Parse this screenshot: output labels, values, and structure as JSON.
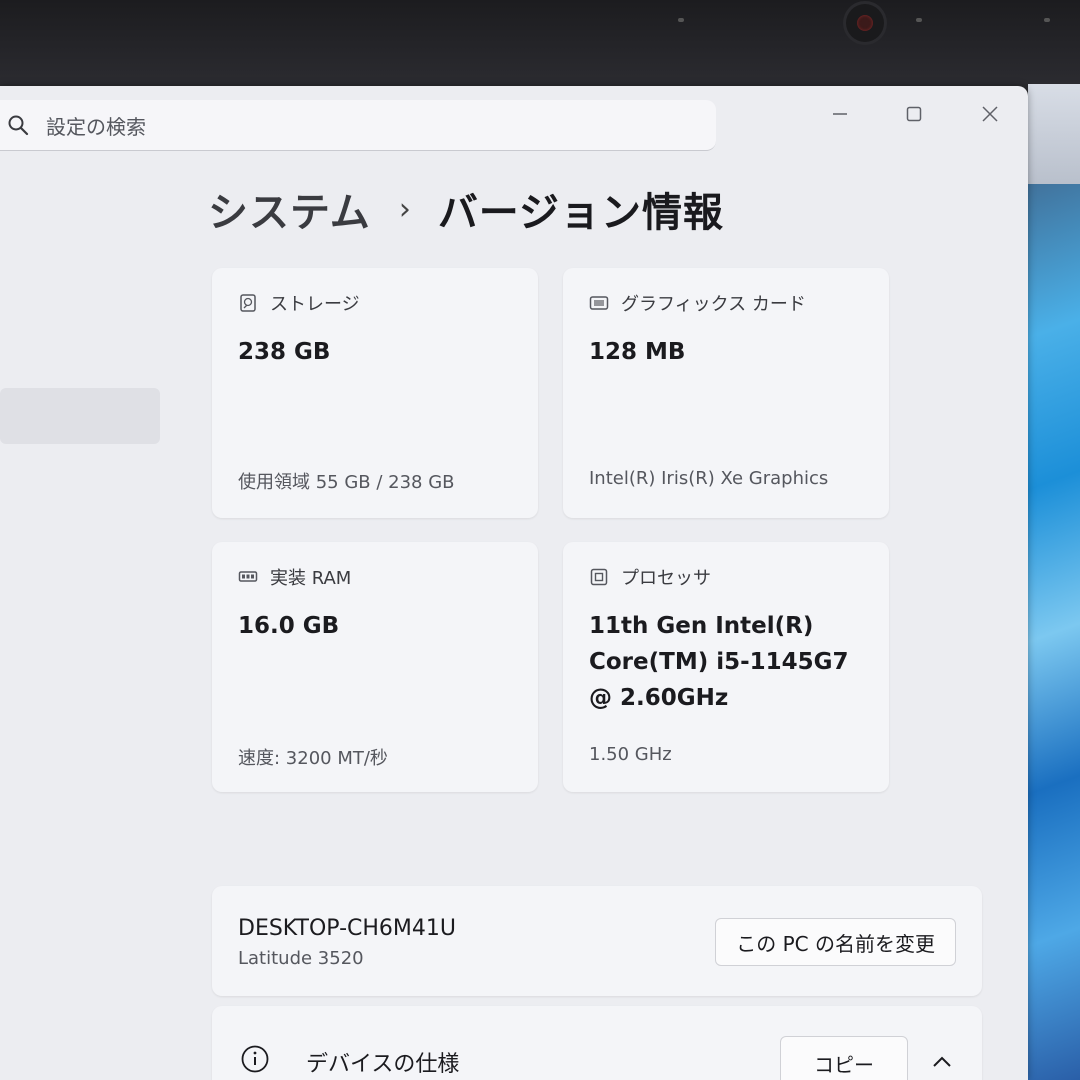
{
  "search": {
    "placeholder": "設定の検索"
  },
  "breadcrumb": {
    "parent": "システム",
    "separator": "›",
    "current": "バージョン情報"
  },
  "cards": {
    "storage": {
      "label": "ストレージ",
      "value": "238 GB",
      "footnote": "使用領域 55 GB / 238 GB",
      "icon": "hard-drive-icon"
    },
    "graphics": {
      "label": "グラフィックス カード",
      "value": "128 MB",
      "footnote": "Intel(R) Iris(R) Xe Graphics",
      "icon": "gpu-icon"
    },
    "ram": {
      "label": "実装 RAM",
      "value": "16.0 GB",
      "footnote": "速度: 3200 MT/秒",
      "icon": "memory-icon"
    },
    "processor": {
      "label": "プロセッサ",
      "value": "11th Gen Intel(R) Core(TM) i5-1145G7 @ 2.60GHz",
      "footnote": "1.50 GHz",
      "icon": "cpu-icon"
    }
  },
  "device": {
    "name": "DESKTOP-CH6M41U",
    "model": "Latitude 3520",
    "rename_label": "この PC の名前を変更"
  },
  "specs": {
    "label": "デバイスの仕様",
    "copy_label": "コピー",
    "icon": "info-icon"
  },
  "colors": {
    "window_bg": "#ecedf1",
    "card_bg": "#f4f5f8",
    "text": "#1b1b1f",
    "secondary_text": "#55575e"
  }
}
